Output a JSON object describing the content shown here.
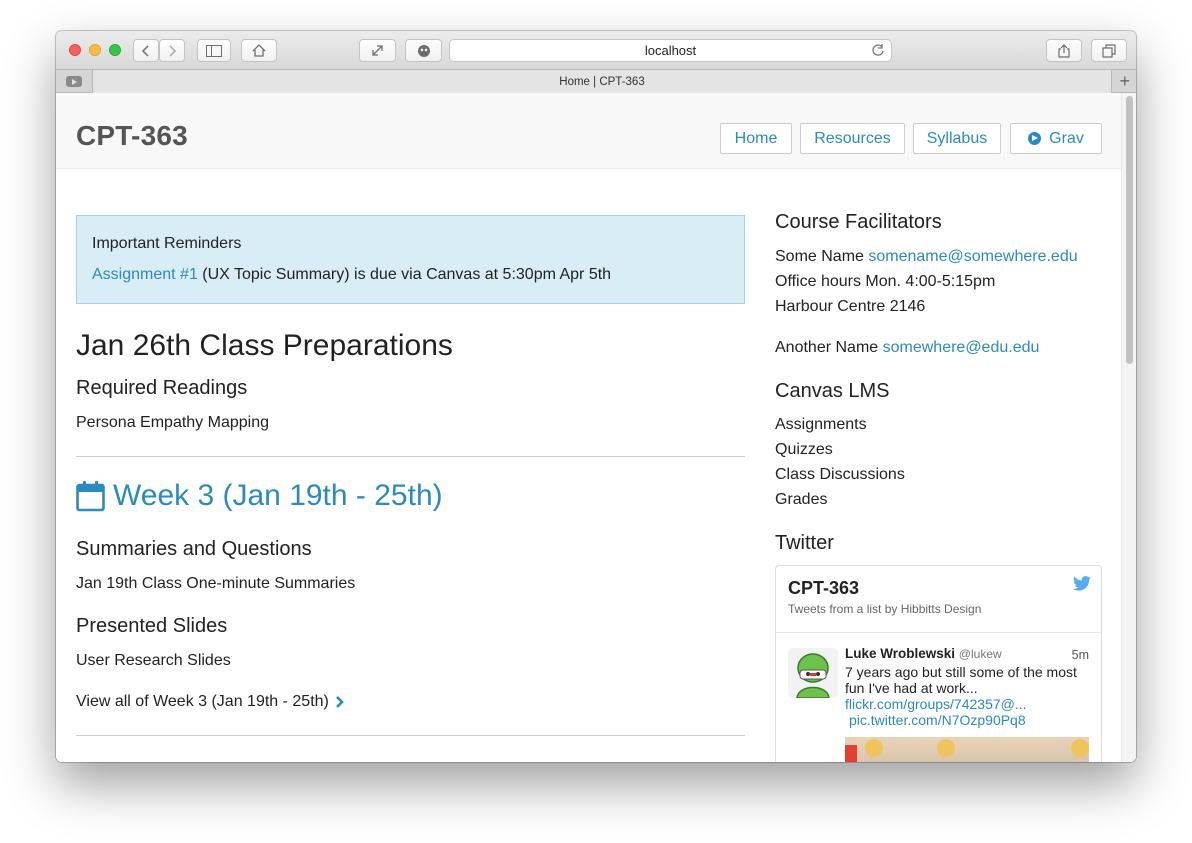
{
  "browser": {
    "address": "localhost",
    "tab_title": "Home | CPT-363"
  },
  "site": {
    "brand": "CPT-363",
    "nav": [
      {
        "label": "Home"
      },
      {
        "label": "Resources"
      },
      {
        "label": "Syllabus"
      },
      {
        "label": "Grav"
      }
    ]
  },
  "reminder": {
    "title": "Important Reminders",
    "link": "Assignment #1",
    "text": " (UX Topic Summary) is due via Canvas at 5:30pm Apr 5th"
  },
  "prep": {
    "heading": "Jan 26th Class Preparations",
    "readings_heading": "Required Readings",
    "reading_link": "Persona Empathy Mapping"
  },
  "week": {
    "heading": "Week 3 (Jan 19th - 25th)",
    "summaries_heading": "Summaries and Questions",
    "summaries_link": "Jan 19th Class One-minute Summaries",
    "slides_heading": "Presented Slides",
    "slides_link": "User Research Slides",
    "view_all": "View all of Week 3 (Jan 19th - 25th)"
  },
  "sidebar": {
    "facilitators_heading": "Course Facilitators",
    "f1_name": "Some Name ",
    "f1_email": "somename@somewhere.edu",
    "f1_hours": "Office hours Mon. 4:00-5:15pm",
    "f1_room": "Harbour Centre 2146",
    "f2_name": "Another Name ",
    "f2_email": "somewhere@edu.edu",
    "canvas_heading": "Canvas LMS",
    "canvas_links": [
      "Assignments",
      "Quizzes",
      "Class Discussions",
      "Grades"
    ],
    "twitter_heading": "Twitter"
  },
  "twitter": {
    "title": "CPT-363",
    "subtitle": "Tweets from a list by Hibbitts Design",
    "tweet": {
      "name": "Luke Wroblewski",
      "handle": "@lukew",
      "time": "5m",
      "text": "7 years ago but still some of the most fun I've had at work...",
      "link1": "flickr.com/groups/742357@...",
      "link2": "pic.twitter.com/N7Ozp90Pq8"
    }
  },
  "colors": {
    "link": "#2a8bbf",
    "alert_bg": "#d9edf7",
    "header_bg": "#f8f8f8"
  }
}
